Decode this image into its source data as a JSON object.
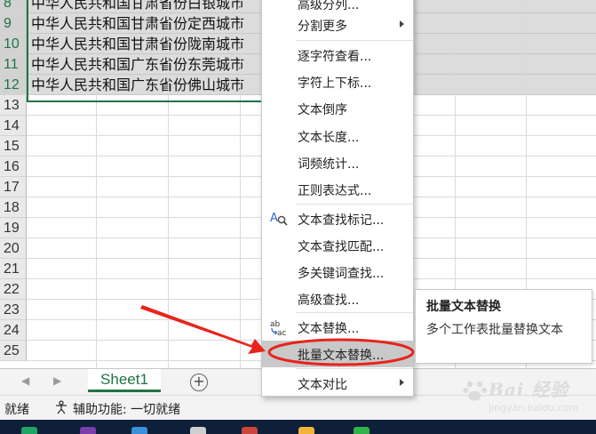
{
  "rows": [
    {
      "num": "8",
      "text": "中华人民共和国甘肃省份白银城市",
      "selected": true
    },
    {
      "num": "9",
      "text": "中华人民共和国甘肃省份定西城市",
      "selected": true
    },
    {
      "num": "10",
      "text": "中华人民共和国甘肃省份陇南城市",
      "selected": true
    },
    {
      "num": "11",
      "text": "中华人民共和国广东省份东莞城市",
      "selected": true
    },
    {
      "num": "12",
      "text": "中华人民共和国广东省份佛山城市",
      "selected": true
    },
    {
      "num": "13",
      "text": "",
      "selected": false
    },
    {
      "num": "14",
      "text": "",
      "selected": false
    },
    {
      "num": "15",
      "text": "",
      "selected": false
    },
    {
      "num": "16",
      "text": "",
      "selected": false
    },
    {
      "num": "17",
      "text": "",
      "selected": false
    },
    {
      "num": "18",
      "text": "",
      "selected": false
    },
    {
      "num": "19",
      "text": "",
      "selected": false
    },
    {
      "num": "20",
      "text": "",
      "selected": false
    },
    {
      "num": "21",
      "text": "",
      "selected": false
    },
    {
      "num": "22",
      "text": "",
      "selected": false
    },
    {
      "num": "23",
      "text": "",
      "selected": false
    },
    {
      "num": "24",
      "text": "",
      "selected": false
    },
    {
      "num": "25",
      "text": "",
      "selected": false
    }
  ],
  "context_menu": {
    "items": [
      {
        "label": "高级分列...",
        "icon": null,
        "submenu": false
      },
      {
        "label": "分割更多",
        "icon": null,
        "submenu": true
      },
      {
        "label": "逐字符查看...",
        "icon": null,
        "submenu": false
      },
      {
        "label": "字符上下标...",
        "icon": null,
        "submenu": false
      },
      {
        "label": "文本倒序",
        "icon": null,
        "submenu": false
      },
      {
        "label": "文本长度...",
        "icon": null,
        "submenu": false
      },
      {
        "label": "词频统计...",
        "icon": null,
        "submenu": false
      },
      {
        "label": "正则表达式...",
        "icon": null,
        "submenu": false
      },
      {
        "label": "文本查找标记...",
        "icon": "find-text-icon",
        "submenu": false
      },
      {
        "label": "文本查找匹配...",
        "icon": null,
        "submenu": false
      },
      {
        "label": "多关键词查找...",
        "icon": null,
        "submenu": false
      },
      {
        "label": "高级查找...",
        "icon": null,
        "submenu": false
      },
      {
        "label": "文本替换...",
        "icon": "replace-ab-ac-icon",
        "submenu": false
      },
      {
        "label": "批量文本替换...",
        "icon": null,
        "submenu": false,
        "highlighted": true
      },
      {
        "label": "文本对比",
        "icon": null,
        "submenu": true
      }
    ]
  },
  "tooltip": {
    "title": "批量文本替换",
    "description": "多个工作表批量替换文本"
  },
  "sheet_tabs": {
    "active": "Sheet1",
    "add_icon": "plus-circle-icon"
  },
  "status_bar": {
    "ready": "就绪",
    "accessibility": "辅助功能: 一切就绪"
  },
  "watermark": {
    "brand": "Bai 经验",
    "url": "jingyan.baidu.com"
  },
  "colors": {
    "accent_green": "#217346",
    "annotation_red": "#e8241c",
    "selection_gray": "#dcdcdc",
    "menu_highlight": "#c9c9c9"
  }
}
